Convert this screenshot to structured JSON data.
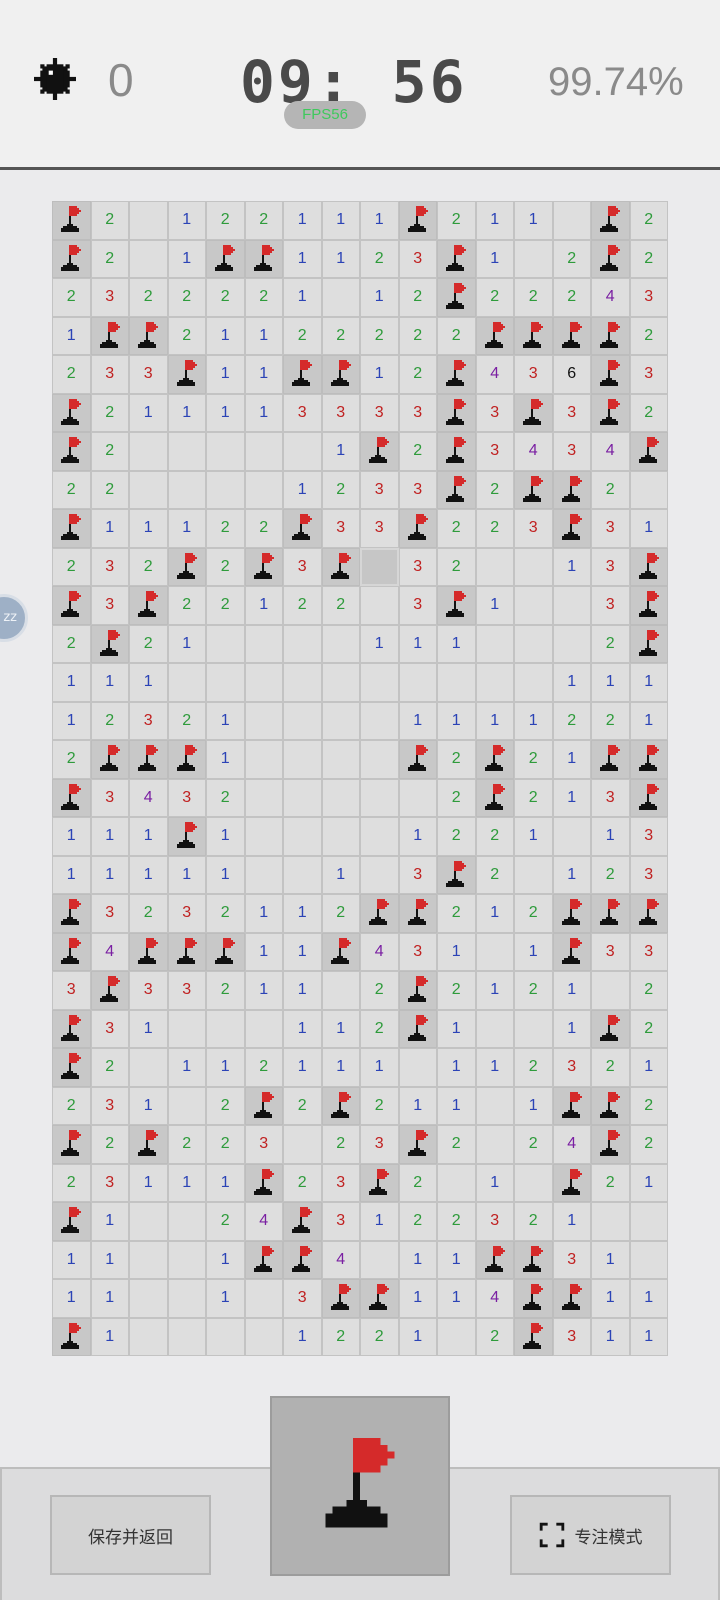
{
  "header": {
    "mine_icon": "mine-icon",
    "mines_remaining": "0",
    "timer": "09: 56",
    "fps": "FPS56",
    "progress": "99.74%"
  },
  "board": {
    "cols": 16,
    "rows": 30,
    "legend": "F = flagged, H = unopened, 0 = empty opened, 1-8 = count",
    "grid": [
      "F20122111F2110F2",
      "F201FF1123F102F2",
      "2322221012F22243",
      "1FF21122222FFFF2",
      "233F11FF12F436F3",
      "F211113333F3F3F2",
      "F2000001F2F3434F",
      "2200001233F2FF20",
      "F11122F33F223F31",
      "232F2F3FH320013F",
      "F3F22122 3F1003F",
      "2F21000011100 2F",
      "1110000000000111",
      "1232100001111221",
      "2FFF10000F2F21FF",
      "F3432000002F213F",
      "111F1000012210130",
      "11111001 3F20123",
      "F3232112FF212FFF",
      "F4FFF11F431 1F332",
      "3F33211 2F2121 2F",
      "F31000112F1001F2",
      "F201121110112321",
      "231 2F2F21101FF20",
      "F2F223 23F2024F2",
      "23111F23F2010F21",
      "F10024F3122321000",
      "11001FF4 11FF3100",
      "11001 3FF114FF111",
      "F1000 1221 2F311F"
    ]
  },
  "controls": {
    "save_label": "保存并返回",
    "focus_label": "专注模式",
    "mode_icon": "flag-icon",
    "side_bubble": "zz"
  },
  "colors": {
    "n1": "#2b43b6",
    "n2": "#2e9b3b",
    "n3": "#c02121",
    "n4": "#7a1fa2",
    "n6": "#111111",
    "flag_red": "#d52a2a",
    "flag_black": "#111111"
  }
}
